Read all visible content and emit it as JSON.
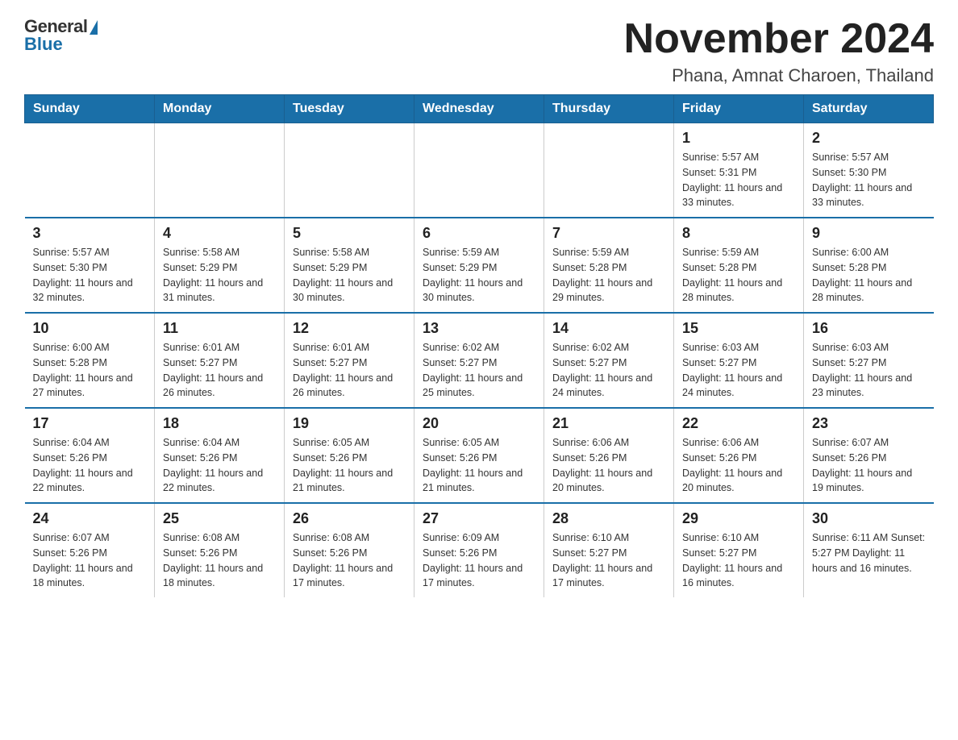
{
  "header": {
    "logo": {
      "general": "General",
      "blue": "Blue"
    },
    "title": "November 2024",
    "subtitle": "Phana, Amnat Charoen, Thailand"
  },
  "days_of_week": [
    "Sunday",
    "Monday",
    "Tuesday",
    "Wednesday",
    "Thursday",
    "Friday",
    "Saturday"
  ],
  "weeks": [
    [
      {
        "day": "",
        "info": ""
      },
      {
        "day": "",
        "info": ""
      },
      {
        "day": "",
        "info": ""
      },
      {
        "day": "",
        "info": ""
      },
      {
        "day": "",
        "info": ""
      },
      {
        "day": "1",
        "info": "Sunrise: 5:57 AM\nSunset: 5:31 PM\nDaylight: 11 hours and 33 minutes."
      },
      {
        "day": "2",
        "info": "Sunrise: 5:57 AM\nSunset: 5:30 PM\nDaylight: 11 hours and 33 minutes."
      }
    ],
    [
      {
        "day": "3",
        "info": "Sunrise: 5:57 AM\nSunset: 5:30 PM\nDaylight: 11 hours and 32 minutes."
      },
      {
        "day": "4",
        "info": "Sunrise: 5:58 AM\nSunset: 5:29 PM\nDaylight: 11 hours and 31 minutes."
      },
      {
        "day": "5",
        "info": "Sunrise: 5:58 AM\nSunset: 5:29 PM\nDaylight: 11 hours and 30 minutes."
      },
      {
        "day": "6",
        "info": "Sunrise: 5:59 AM\nSunset: 5:29 PM\nDaylight: 11 hours and 30 minutes."
      },
      {
        "day": "7",
        "info": "Sunrise: 5:59 AM\nSunset: 5:28 PM\nDaylight: 11 hours and 29 minutes."
      },
      {
        "day": "8",
        "info": "Sunrise: 5:59 AM\nSunset: 5:28 PM\nDaylight: 11 hours and 28 minutes."
      },
      {
        "day": "9",
        "info": "Sunrise: 6:00 AM\nSunset: 5:28 PM\nDaylight: 11 hours and 28 minutes."
      }
    ],
    [
      {
        "day": "10",
        "info": "Sunrise: 6:00 AM\nSunset: 5:28 PM\nDaylight: 11 hours and 27 minutes."
      },
      {
        "day": "11",
        "info": "Sunrise: 6:01 AM\nSunset: 5:27 PM\nDaylight: 11 hours and 26 minutes."
      },
      {
        "day": "12",
        "info": "Sunrise: 6:01 AM\nSunset: 5:27 PM\nDaylight: 11 hours and 26 minutes."
      },
      {
        "day": "13",
        "info": "Sunrise: 6:02 AM\nSunset: 5:27 PM\nDaylight: 11 hours and 25 minutes."
      },
      {
        "day": "14",
        "info": "Sunrise: 6:02 AM\nSunset: 5:27 PM\nDaylight: 11 hours and 24 minutes."
      },
      {
        "day": "15",
        "info": "Sunrise: 6:03 AM\nSunset: 5:27 PM\nDaylight: 11 hours and 24 minutes."
      },
      {
        "day": "16",
        "info": "Sunrise: 6:03 AM\nSunset: 5:27 PM\nDaylight: 11 hours and 23 minutes."
      }
    ],
    [
      {
        "day": "17",
        "info": "Sunrise: 6:04 AM\nSunset: 5:26 PM\nDaylight: 11 hours and 22 minutes."
      },
      {
        "day": "18",
        "info": "Sunrise: 6:04 AM\nSunset: 5:26 PM\nDaylight: 11 hours and 22 minutes."
      },
      {
        "day": "19",
        "info": "Sunrise: 6:05 AM\nSunset: 5:26 PM\nDaylight: 11 hours and 21 minutes."
      },
      {
        "day": "20",
        "info": "Sunrise: 6:05 AM\nSunset: 5:26 PM\nDaylight: 11 hours and 21 minutes."
      },
      {
        "day": "21",
        "info": "Sunrise: 6:06 AM\nSunset: 5:26 PM\nDaylight: 11 hours and 20 minutes."
      },
      {
        "day": "22",
        "info": "Sunrise: 6:06 AM\nSunset: 5:26 PM\nDaylight: 11 hours and 20 minutes."
      },
      {
        "day": "23",
        "info": "Sunrise: 6:07 AM\nSunset: 5:26 PM\nDaylight: 11 hours and 19 minutes."
      }
    ],
    [
      {
        "day": "24",
        "info": "Sunrise: 6:07 AM\nSunset: 5:26 PM\nDaylight: 11 hours and 18 minutes."
      },
      {
        "day": "25",
        "info": "Sunrise: 6:08 AM\nSunset: 5:26 PM\nDaylight: 11 hours and 18 minutes."
      },
      {
        "day": "26",
        "info": "Sunrise: 6:08 AM\nSunset: 5:26 PM\nDaylight: 11 hours and 17 minutes."
      },
      {
        "day": "27",
        "info": "Sunrise: 6:09 AM\nSunset: 5:26 PM\nDaylight: 11 hours and 17 minutes."
      },
      {
        "day": "28",
        "info": "Sunrise: 6:10 AM\nSunset: 5:27 PM\nDaylight: 11 hours and 17 minutes."
      },
      {
        "day": "29",
        "info": "Sunrise: 6:10 AM\nSunset: 5:27 PM\nDaylight: 11 hours and 16 minutes."
      },
      {
        "day": "30",
        "info": "Sunrise: 6:11 AM\nSunset: 5:27 PM\nDaylight: 11 hours and 16 minutes."
      }
    ]
  ]
}
